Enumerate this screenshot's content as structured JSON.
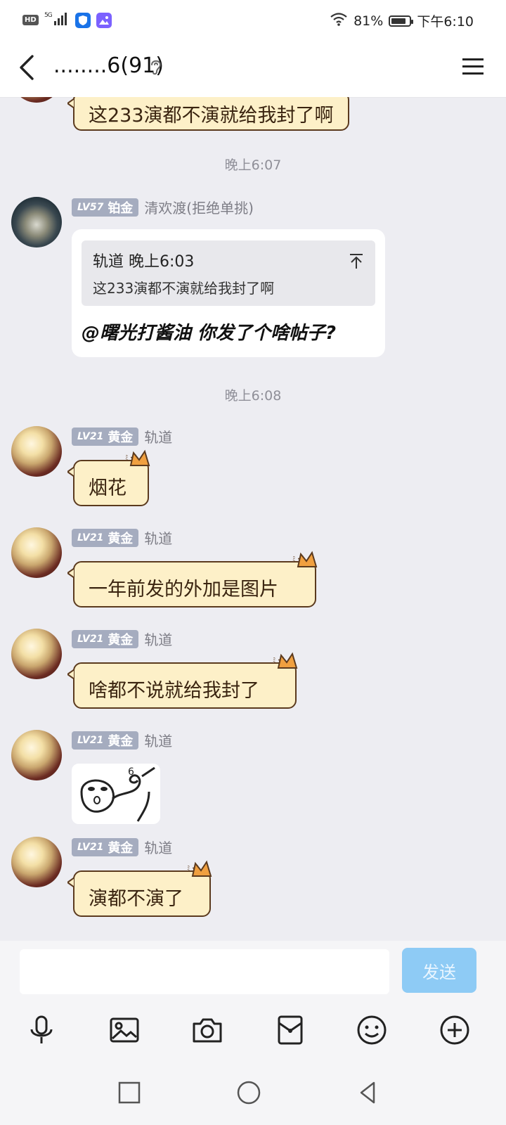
{
  "status": {
    "left": {
      "hd": "HD",
      "net": "5G"
    },
    "battery_pct": "81%",
    "battery_level": 0.81,
    "time": "下午6:10"
  },
  "header": {
    "title": "........6(91)"
  },
  "chat": {
    "first_bubble": "这233演都不演就给我封了啊",
    "time1": "晚上6:07",
    "msg1": {
      "level": "LV57",
      "rank": "铂金",
      "nick": "清欢渡(拒绝单挑)",
      "quote_head": "轨道 晚上6:03",
      "quote_text": "这233演都不演就给我封了啊",
      "mention": "@曙光打酱油 你发了个啥帖子?"
    },
    "time2": "晚上6:08",
    "messages": [
      {
        "level": "LV21",
        "rank": "黄金",
        "nick": "轨道",
        "text": "烟花"
      },
      {
        "level": "LV21",
        "rank": "黄金",
        "nick": "轨道",
        "text": "一年前发的外加是图片"
      },
      {
        "level": "LV21",
        "rank": "黄金",
        "nick": "轨道",
        "text": "啥都不说就给我封了"
      },
      {
        "level": "LV21",
        "rank": "黄金",
        "nick": "轨道",
        "sticker": "meme-sticker"
      },
      {
        "level": "LV21",
        "rank": "黄金",
        "nick": "轨道",
        "text": "演都不演了"
      }
    ]
  },
  "input": {
    "placeholder": "",
    "send_label": "发送"
  },
  "toolbar": [
    "microphone-icon",
    "image-icon",
    "camera-icon",
    "red-packet-icon",
    "emoji-icon",
    "plus-icon"
  ],
  "nav": [
    "recent-apps",
    "home",
    "back"
  ],
  "colors": {
    "bubble_fill": "#fdf0c8",
    "bubble_border": "#5b3a1e",
    "badge": "#a5acbf",
    "send": "#8ecbf5"
  }
}
